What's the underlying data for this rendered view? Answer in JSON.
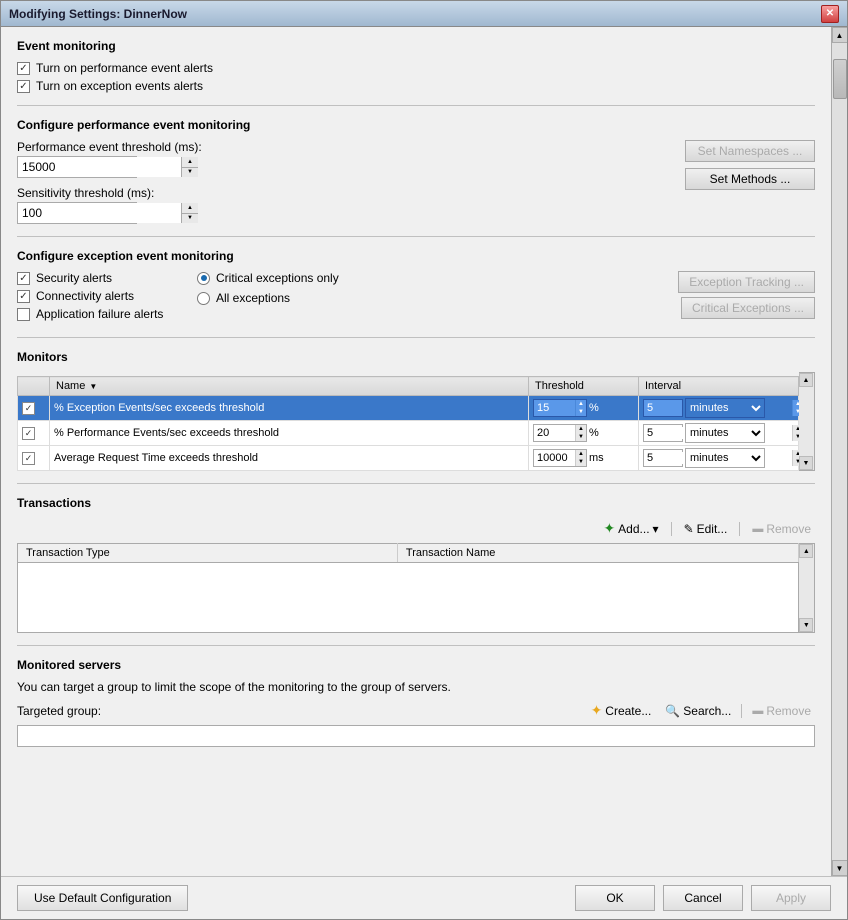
{
  "window": {
    "title": "Modifying Settings: DinnerNow"
  },
  "event_monitoring": {
    "section_title": "Event monitoring",
    "alert1_label": "Turn on performance event alerts",
    "alert2_label": "Turn on exception events alerts",
    "alert1_checked": true,
    "alert2_checked": true
  },
  "perf_monitoring": {
    "section_title": "Configure performance event monitoring",
    "perf_threshold_label": "Performance event threshold (ms):",
    "perf_threshold_value": "15000",
    "sensitivity_label": "Sensitivity threshold (ms):",
    "sensitivity_value": "100",
    "btn_namespaces": "Set Namespaces ...",
    "btn_methods": "Set Methods ..."
  },
  "exception_monitoring": {
    "section_title": "Configure exception event monitoring",
    "check1_label": "Security alerts",
    "check1_checked": true,
    "check2_label": "Connectivity alerts",
    "check2_checked": true,
    "check3_label": "Application failure alerts",
    "check3_checked": false,
    "radio1_label": "Critical exceptions only",
    "radio1_checked": true,
    "radio2_label": "All exceptions",
    "radio2_checked": false,
    "btn_exception_tracking": "Exception Tracking ...",
    "btn_critical_exceptions": "Critical Exceptions ..."
  },
  "monitors": {
    "section_title": "Monitors",
    "columns": [
      "Name",
      "Threshold",
      "Interval"
    ],
    "rows": [
      {
        "checked": true,
        "name": "% Exception Events/sec exceeds threshold",
        "threshold_value": "15",
        "threshold_unit": "%",
        "interval_value": "5",
        "interval_unit": "minutes",
        "selected": true
      },
      {
        "checked": true,
        "name": "% Performance Events/sec exceeds threshold",
        "threshold_value": "20",
        "threshold_unit": "%",
        "interval_value": "5",
        "interval_unit": "minutes",
        "selected": false
      },
      {
        "checked": true,
        "name": "Average Request Time exceeds threshold",
        "threshold_value": "10000",
        "threshold_unit": "ms",
        "interval_value": "5",
        "interval_unit": "minutes",
        "selected": false
      }
    ]
  },
  "transactions": {
    "section_title": "Transactions",
    "btn_add": "Add...",
    "btn_edit": "Edit...",
    "btn_remove": "Remove",
    "col1": "Transaction Type",
    "col2": "Transaction Name"
  },
  "monitored_servers": {
    "section_title": "Monitored servers",
    "description": "You can target a group to limit the scope of the monitoring to the group of servers.",
    "targeted_label": "Targeted group:",
    "btn_create": "Create...",
    "btn_search": "Search...",
    "btn_remove": "Remove"
  },
  "bottom": {
    "btn_default": "Use Default Configuration",
    "btn_ok": "OK",
    "btn_cancel": "Cancel",
    "btn_apply": "Apply"
  }
}
